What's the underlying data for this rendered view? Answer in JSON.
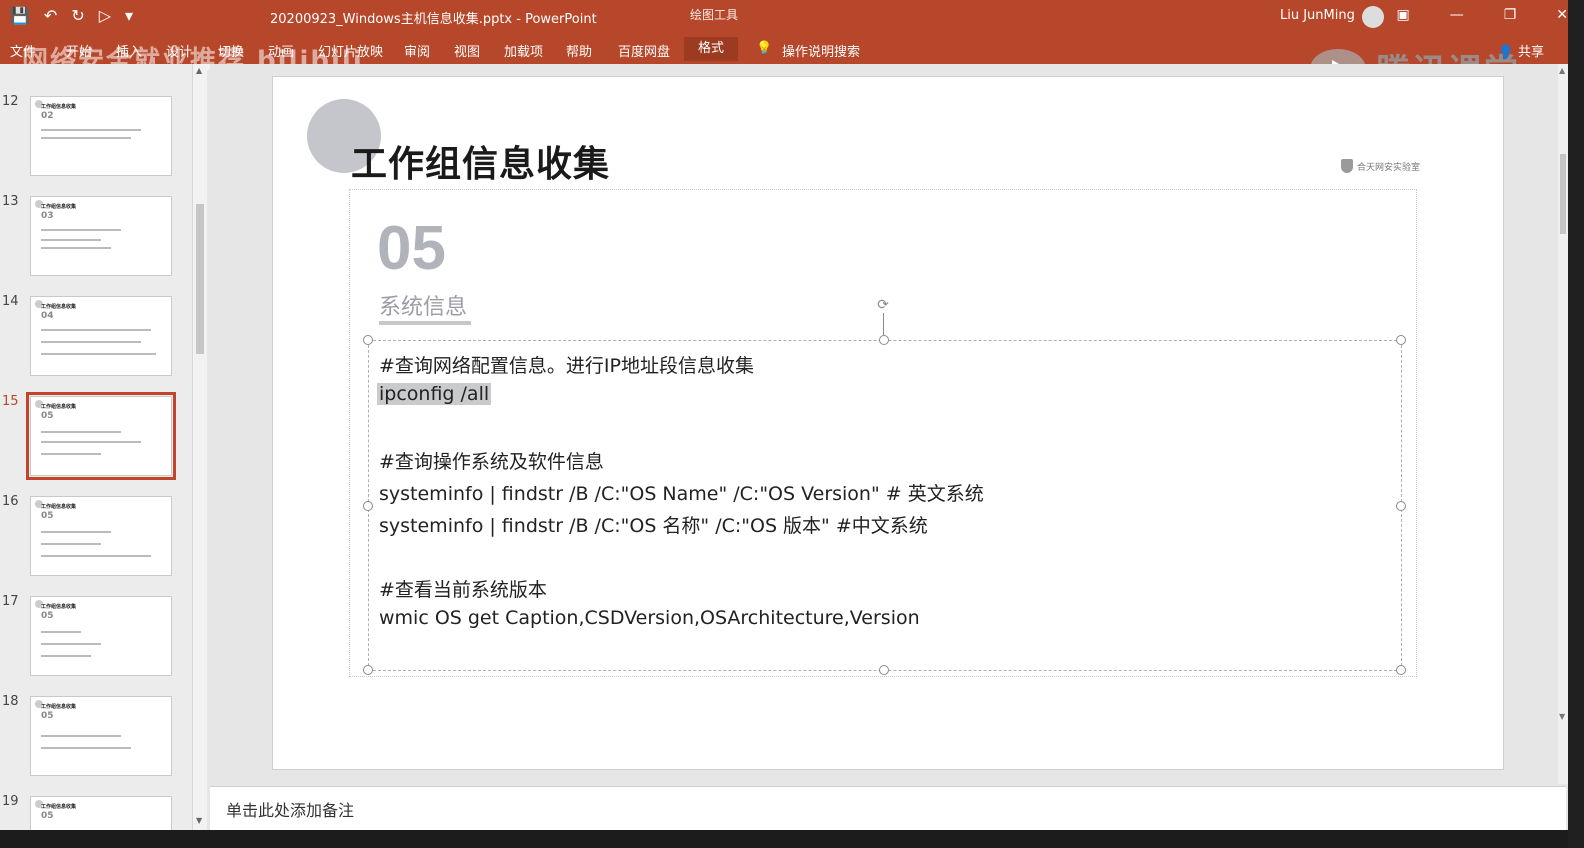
{
  "titlebar": {
    "document_title": "20200923_Windows主机信息收集.pptx  -  PowerPoint",
    "context_tab": "绘图工具",
    "user_name": "Liu JunMing",
    "quick_access": [
      "save-icon",
      "undo-icon",
      "redo-icon",
      "present-icon",
      "customize-icon"
    ],
    "window_buttons": [
      "ribbon-display-icon",
      "minimize-icon",
      "restore-icon",
      "close-icon"
    ]
  },
  "ribbon": {
    "tabs": [
      "文件",
      "开始",
      "插入",
      "设计",
      "切换",
      "动画",
      "幻灯片放映",
      "审阅",
      "视图",
      "加载项",
      "帮助",
      "百度网盘",
      "格式"
    ],
    "active_tab": "格式",
    "tell_me": "操作说明搜索",
    "share": "共享"
  },
  "watermarks": {
    "left": "网络安全就业推荐  bilibili",
    "right": "腾讯课堂"
  },
  "thumbnails": [
    {
      "num": "12",
      "title": "工作组信息收集",
      "label": "02",
      "active": false
    },
    {
      "num": "13",
      "title": "工作组信息收集",
      "label": "03",
      "active": false
    },
    {
      "num": "14",
      "title": "工作组信息收集",
      "label": "04",
      "active": false
    },
    {
      "num": "15",
      "title": "工作组信息收集",
      "label": "05",
      "active": true
    },
    {
      "num": "16",
      "title": "工作组信息收集",
      "label": "05",
      "active": false
    },
    {
      "num": "17",
      "title": "工作组信息收集",
      "label": "05",
      "active": false
    },
    {
      "num": "18",
      "title": "工作组信息收集",
      "label": "05",
      "active": false
    },
    {
      "num": "19",
      "title": "工作组信息收集",
      "label": "05",
      "active": false
    }
  ],
  "slide": {
    "title": "工作组信息收集",
    "number": "05",
    "subtitle": "系统信息",
    "logo_text": "合天网安实验室",
    "body_lines": [
      "#查询网络配置信息。进行IP地址段信息收集",
      "ipconfig /all",
      "",
      "#查询操作系统及软件信息",
      "systeminfo | findstr /B /C:\"OS Name\" /C:\"OS Version\" # 英文系统",
      "systeminfo | findstr /B /C:\"OS 名称\" /C:\"OS 版本\" #中文系统",
      "",
      "#查看当前系统版本",
      "wmic OS get Caption,CSDVersion,OSArchitecture,Version"
    ],
    "selected_line": "ipconfig /all"
  },
  "notes": {
    "placeholder": "单击此处添加备注"
  },
  "colors": {
    "ribbon": "#b7472a",
    "active_thumb_border": "#c0452a",
    "slide_number": "#b0b3ba"
  }
}
